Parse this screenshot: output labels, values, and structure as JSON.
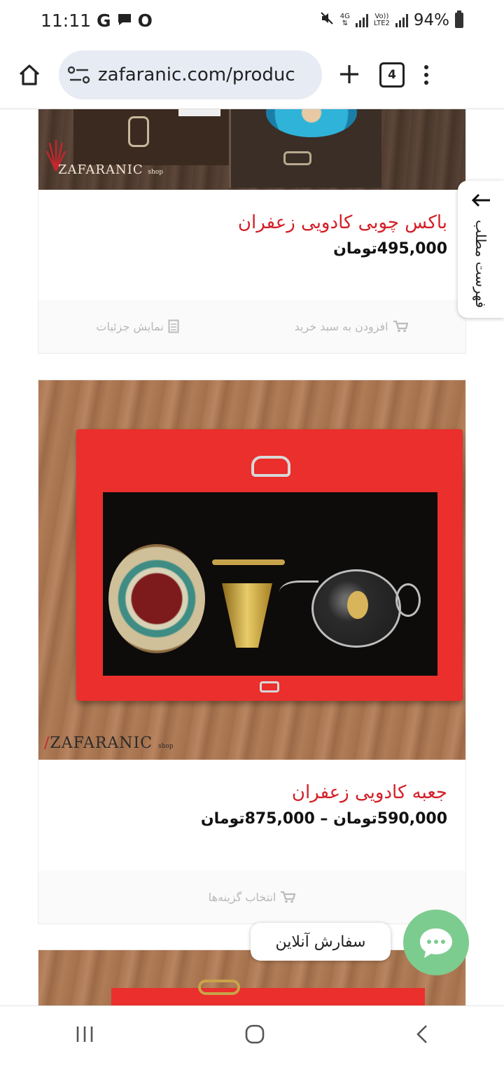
{
  "status_bar": {
    "time": "11:11",
    "g_label": "G",
    "o_label": "O",
    "net_4g": "4G",
    "volte": "Vo))",
    "lte2": "LTE2",
    "battery": "94%"
  },
  "browser": {
    "url": "zafaranic.com/produc",
    "tab_count": "4"
  },
  "toc": {
    "label": "فهرست مطلب"
  },
  "products": [
    {
      "title": "باکس چوبی کادویی زعفران",
      "price": "495,000تومان",
      "watermark": "ZAFARANIC",
      "watermark_small": "shop",
      "actions": {
        "add_to_cart": "افزودن به سبد خرید",
        "details": "نمایش جزئیات"
      }
    },
    {
      "title": "جعبه کادویی زعفران",
      "price": "590,000تومان – 875,000تومان",
      "watermark": "ZAFARANIC",
      "watermark_small": "shop",
      "actions": {
        "choose_options": "انتخاب گزینه‌ها"
      }
    }
  ],
  "chat": {
    "label": "سفارش آنلاین"
  },
  "colors": {
    "title_red": "#d31f26",
    "chat_green": "#7dcc8f",
    "url_pill": "#e7ebf4"
  }
}
